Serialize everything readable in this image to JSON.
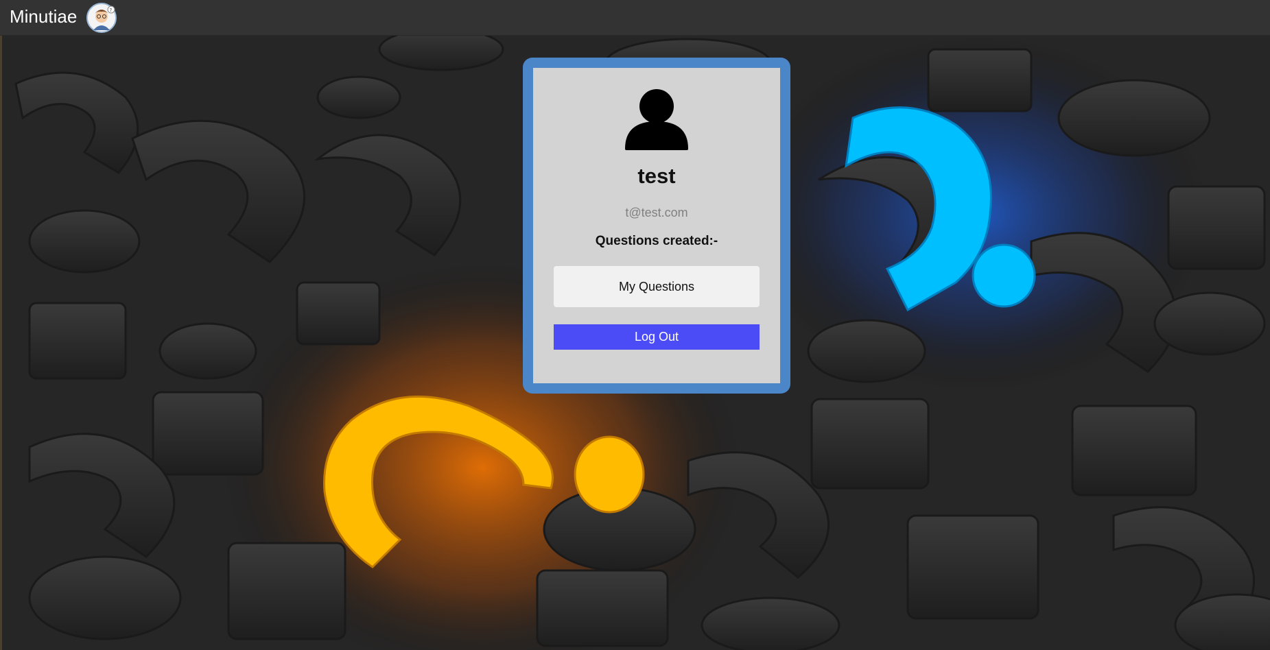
{
  "app": {
    "title": "Minutiae"
  },
  "profile": {
    "username": "test",
    "email": "t@test.com",
    "questions_created_label": "Questions created:-"
  },
  "actions": {
    "my_questions_label": "My Questions",
    "logout_label": "Log Out"
  },
  "icons": {
    "brand_avatar": "user-cartoon-avatar-icon",
    "profile_avatar": "user-silhouette-icon"
  },
  "colors": {
    "navbar_bg": "#333333",
    "card_frame": "#4a86c8",
    "card_bg": "#d3d3d3",
    "logout_button": "#4b4cf5",
    "my_questions_button": "#f1f1f1",
    "accent_orange": "#ffba00",
    "accent_blue": "#00bfff"
  }
}
